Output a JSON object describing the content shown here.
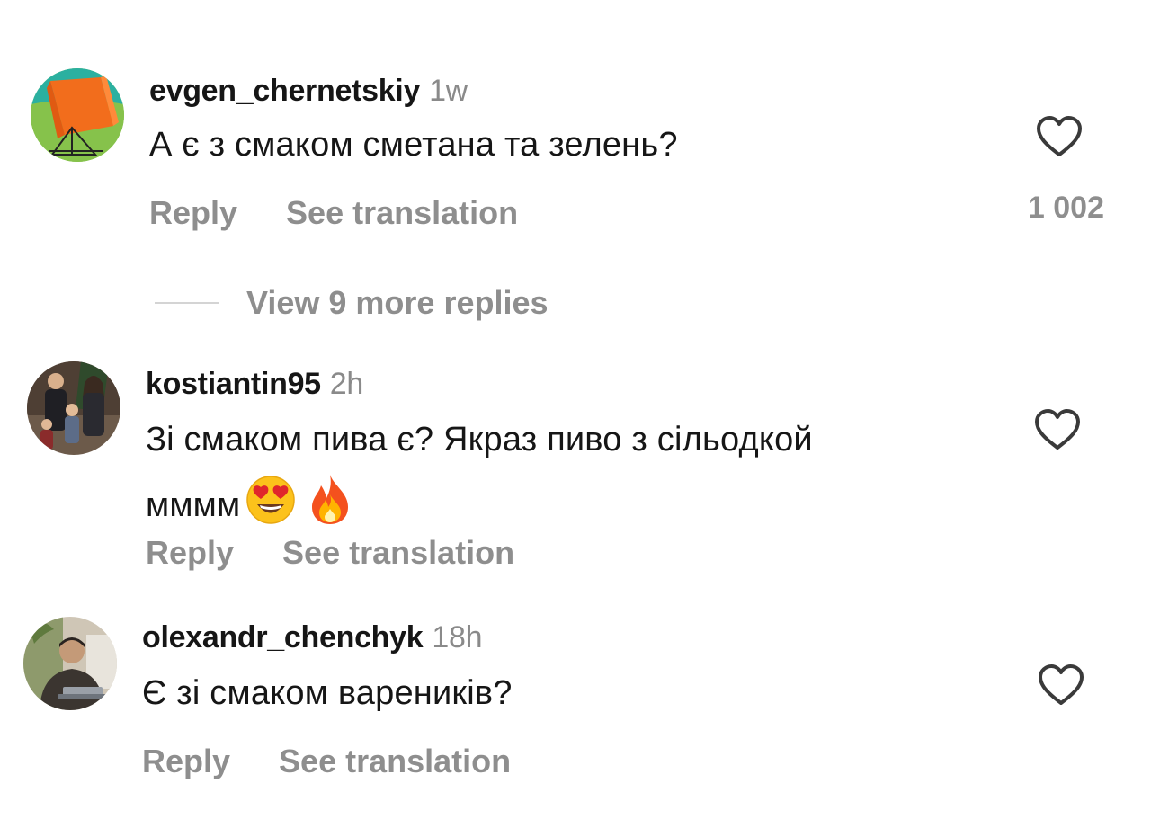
{
  "comments": [
    {
      "username": "evgen_chernetskiy",
      "time": "1w",
      "text": "А є з смаком сметана та зелень?",
      "text_tail": "",
      "reply_label": "Reply",
      "translate_label": "See translation",
      "like_count": "1 002",
      "avatar_icon": "tent-avatar"
    },
    {
      "username": "kostiantin95",
      "time": "2h",
      "text": "Зі смаком пива є? Якраз пиво з сільодкой",
      "text_tail": "мммм",
      "emojis": [
        "😍",
        "🔥"
      ],
      "reply_label": "Reply",
      "translate_label": "See translation",
      "avatar_icon": "family-photo-avatar"
    },
    {
      "username": "olexandr_chenchyk",
      "time": "18h",
      "text": "Є зі смаком вареників?",
      "text_tail": "",
      "reply_label": "Reply",
      "translate_label": "See translation",
      "avatar_icon": "man-photo-avatar"
    }
  ],
  "view_more_replies": "View 9 more replies",
  "colors": {
    "text": "#161616",
    "muted": "#8e8e8e",
    "divider": "#d4d4d4"
  }
}
